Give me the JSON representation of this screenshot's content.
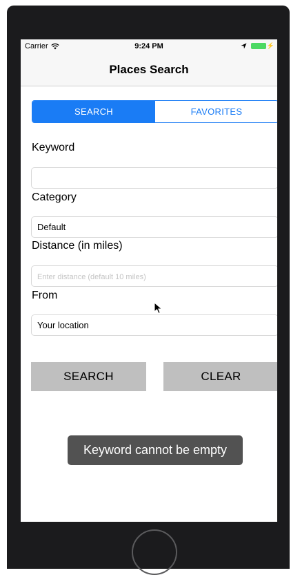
{
  "status_bar": {
    "carrier": "Carrier",
    "time": "9:24 PM",
    "icons": [
      "wifi-icon",
      "location-arrow-icon",
      "battery-icon"
    ],
    "battery_color": "#4cd964"
  },
  "nav": {
    "title": "Places Search"
  },
  "tabs": [
    {
      "label": "SEARCH",
      "active": true
    },
    {
      "label": "FAVORITES",
      "active": false
    }
  ],
  "form": {
    "keyword": {
      "label": "Keyword",
      "value": "",
      "placeholder": ""
    },
    "category": {
      "label": "Category",
      "value": "Default"
    },
    "distance": {
      "label": "Distance (in miles)",
      "value": "",
      "placeholder": "Enter distance (default 10 miles)"
    },
    "from": {
      "label": "From",
      "value": "Your location"
    }
  },
  "buttons": {
    "search_label": "SEARCH",
    "clear_label": "CLEAR"
  },
  "toast": {
    "message": "Keyword cannot be empty"
  },
  "colors": {
    "accent": "#1a7cf5",
    "button_bg": "#bfbfbf",
    "toast_bg": "#525252",
    "device_frame": "#1b1b1d"
  }
}
